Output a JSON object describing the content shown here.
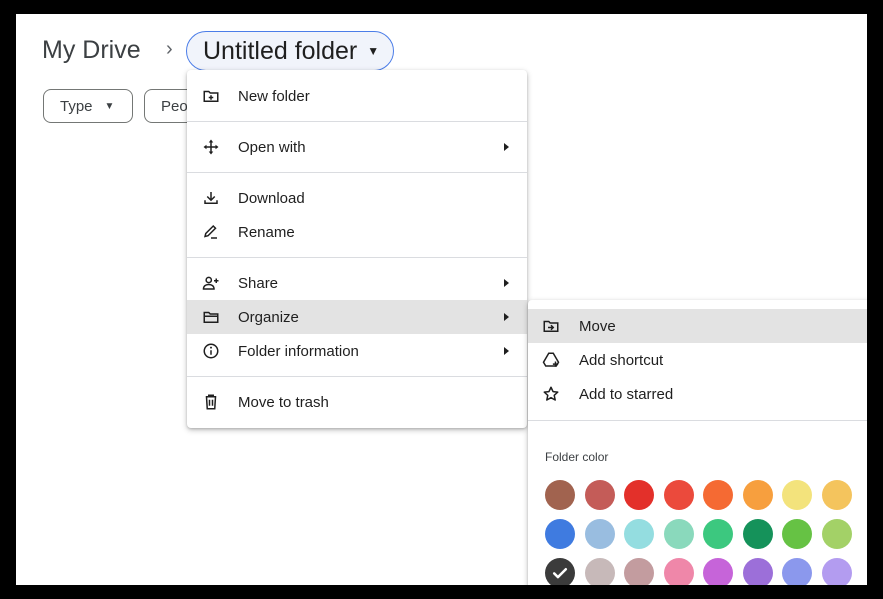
{
  "breadcrumb": {
    "root": "My Drive",
    "separator": "›",
    "current": "Untitled folder"
  },
  "filters": [
    {
      "label": "Type"
    },
    {
      "label": "Peo"
    }
  ],
  "context_menu": {
    "items": [
      {
        "label": "New folder",
        "icon": "new-folder-icon"
      },
      {
        "label": "Open with",
        "icon": "open-with-icon",
        "submenu": true
      },
      {
        "label": "Download",
        "icon": "download-icon"
      },
      {
        "label": "Rename",
        "icon": "rename-icon"
      },
      {
        "label": "Share",
        "icon": "share-icon",
        "submenu": true
      },
      {
        "label": "Organize",
        "icon": "organize-icon",
        "submenu": true,
        "highlighted": true
      },
      {
        "label": "Folder information",
        "icon": "info-icon",
        "submenu": true
      },
      {
        "label": "Move to trash",
        "icon": "trash-icon"
      }
    ]
  },
  "organize_submenu": {
    "items": [
      {
        "label": "Move",
        "icon": "move-icon",
        "highlighted": true
      },
      {
        "label": "Add shortcut",
        "icon": "add-shortcut-icon"
      },
      {
        "label": "Add to starred",
        "icon": "star-icon"
      }
    ],
    "folder_color_title": "Folder color",
    "colors": [
      [
        "#a1634f",
        "#c45c58",
        "#e3302a",
        "#eb4a3c",
        "#f56a33",
        "#f79f3e",
        "#f3e37c",
        "#f4c45d"
      ],
      [
        "#3f7be0",
        "#99bde0",
        "#94dde0",
        "#8ad9bc",
        "#3cc87f",
        "#15925a",
        "#66c244",
        "#a3d167"
      ],
      [
        "#3b3b3b",
        "#c7b9b9",
        "#c39c9f",
        "#ef87a9",
        "#c664d9",
        "#9c6fd9",
        "#8b98ed",
        "#b39cf0"
      ]
    ],
    "selected_color": "#3b3b3b"
  }
}
